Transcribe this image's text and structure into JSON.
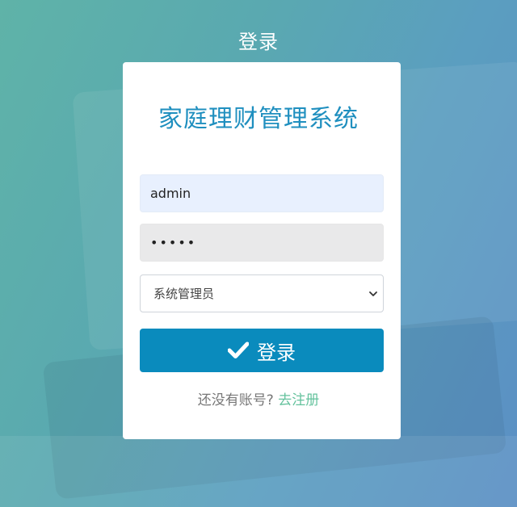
{
  "page": {
    "heading": "登录"
  },
  "card": {
    "title": "家庭理财管理系统"
  },
  "form": {
    "username_value": "admin",
    "password_value": "•••••",
    "role_selected": "系统管理员"
  },
  "actions": {
    "login_label": "登录",
    "register_prompt": "还没有账号?",
    "register_link": "去注册"
  },
  "colors": {
    "accent": "#0a8bbd",
    "title": "#1f8fbf",
    "link": "#64c29d"
  },
  "icons": {
    "login": "check-icon",
    "select": "chevron-down-icon"
  }
}
